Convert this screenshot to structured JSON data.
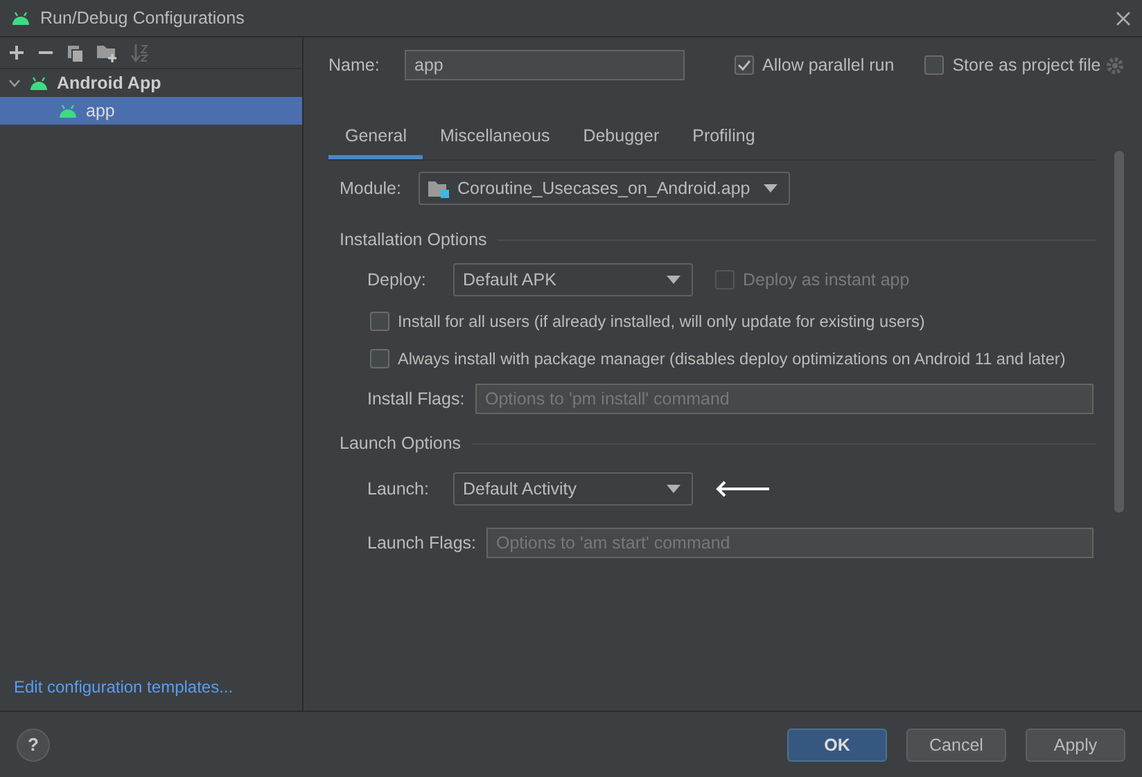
{
  "window": {
    "title": "Run/Debug Configurations"
  },
  "tree": [
    {
      "label": "Android App",
      "expanded": true,
      "selected": false,
      "children": [
        {
          "label": "app",
          "selected": true
        }
      ]
    }
  ],
  "edit_templates_link": "Edit configuration templates...",
  "name_field": {
    "label": "Name:",
    "value": "app"
  },
  "allow_parallel_run": {
    "label": "Allow parallel run",
    "checked": true
  },
  "store_as_project_file": {
    "label": "Store as project file",
    "checked": false
  },
  "tabs": [
    {
      "label": "General",
      "selected": true
    },
    {
      "label": "Miscellaneous",
      "selected": false
    },
    {
      "label": "Debugger",
      "selected": false
    },
    {
      "label": "Profiling",
      "selected": false
    }
  ],
  "module": {
    "label": "Module:",
    "value": "Coroutine_Usecases_on_Android.app"
  },
  "installation_options": {
    "title": "Installation Options",
    "deploy": {
      "label": "Deploy:",
      "value": "Default APK"
    },
    "deploy_instant": {
      "label": "Deploy as instant app",
      "checked": false,
      "disabled": true
    },
    "checkboxes": [
      {
        "label": "Install for all users (if already installed, will only update for existing users)",
        "checked": false
      },
      {
        "label": "Always install with package manager (disables deploy optimizations on Android 11 and later)",
        "checked": false
      }
    ],
    "install_flags": {
      "label": "Install Flags:",
      "placeholder": "Options to 'pm install' command"
    }
  },
  "launch_options": {
    "title": "Launch Options",
    "launch": {
      "label": "Launch:",
      "value": "Default Activity"
    },
    "launch_flags": {
      "label": "Launch Flags:",
      "placeholder": "Options to 'am start' command"
    }
  },
  "help": "?",
  "buttons": [
    {
      "label": "OK",
      "kind": "primary"
    },
    {
      "label": "Cancel",
      "kind": "normal"
    },
    {
      "label": "Apply",
      "kind": "normal"
    }
  ]
}
